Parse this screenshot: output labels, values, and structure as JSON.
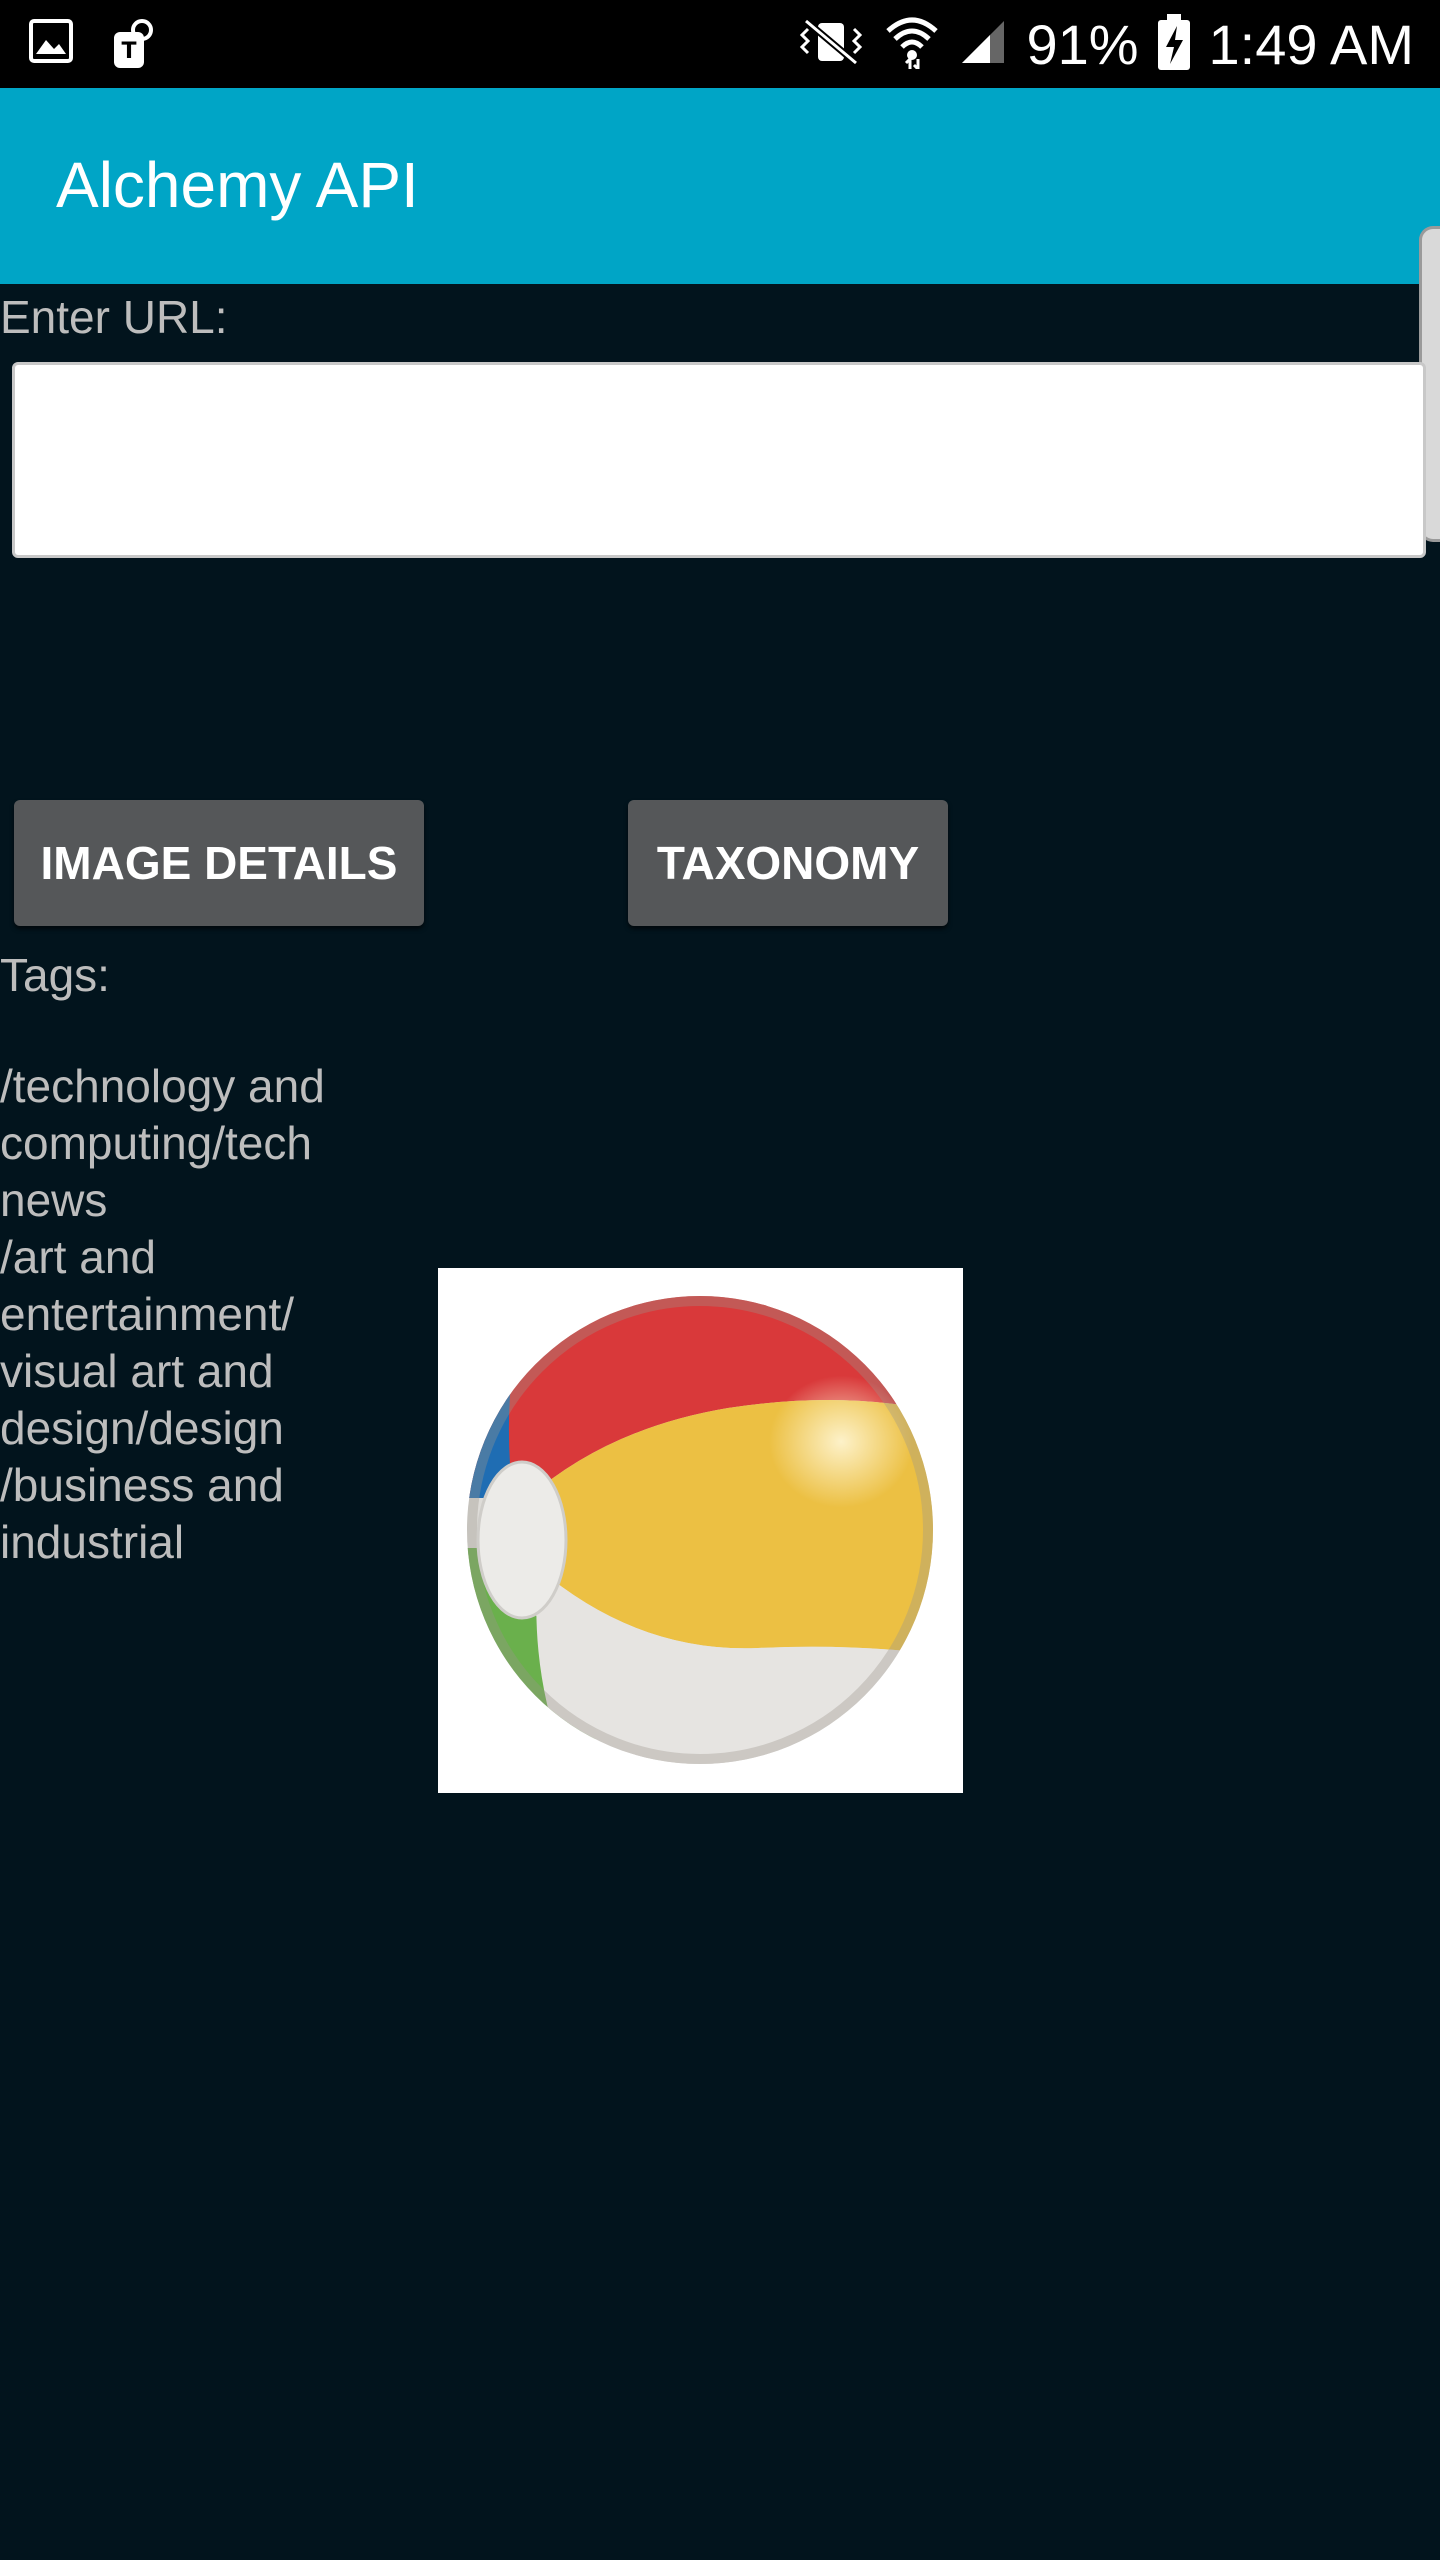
{
  "status_bar": {
    "left_icons": [
      "gallery-icon",
      "t-mobile-icon"
    ],
    "right_icons": [
      "vibrate-mute-icon",
      "wifi-icon",
      "cell-signal-icon",
      "battery-charging-icon"
    ],
    "battery": "91%",
    "time": "1:49 AM"
  },
  "app_bar": {
    "title": "Alchemy API",
    "color": "#00a5c6"
  },
  "form": {
    "url_label": "Enter URL:",
    "url_value": ""
  },
  "buttons": {
    "image_details": "IMAGE DETAILS",
    "taxonomy": "TAXONOMY"
  },
  "results": {
    "tags_label": "Tags:",
    "tag_lines": [
      "/technology and",
      "computing/tech",
      "news",
      "/art and",
      "entertainment/",
      "visual art and",
      "design/design",
      "/business and",
      "industrial"
    ]
  },
  "image": {
    "subject": "beach-ball"
  }
}
